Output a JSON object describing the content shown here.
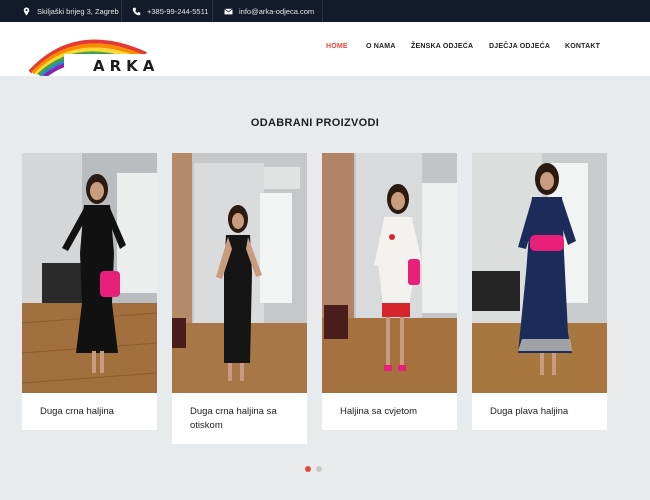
{
  "topbar": {
    "address": "Skiljaški brijeg 3, Zagreb",
    "phone": "+385-99-244-5511",
    "email": "info@arka-odjeca.com"
  },
  "brand": {
    "logo_text": "ARKA"
  },
  "nav": {
    "items": [
      {
        "label": "HOME",
        "active": true
      },
      {
        "label": "O NAMA",
        "active": false
      },
      {
        "label": "ŽENSKA ODJEĆA",
        "active": false
      },
      {
        "label": "DJEČJA ODJEĆA",
        "active": false
      },
      {
        "label": "KONTAKT",
        "active": false
      }
    ]
  },
  "section": {
    "title": "ODABRANI PROIZVODI"
  },
  "products": [
    {
      "name": "Duga crna haljina",
      "dress_color": "#111111"
    },
    {
      "name": "Duga crna haljina sa otiskom",
      "dress_color": "#141414"
    },
    {
      "name": "Haljina sa cvjetom",
      "dress_color": "#f4f2ef"
    },
    {
      "name": "Duga plava haljina",
      "dress_color": "#1c2c5a"
    }
  ],
  "carousel": {
    "pages": 2,
    "active_page": 1
  },
  "colors": {
    "accent": "#e54a3f",
    "topbar_bg": "#131a2a",
    "page_bg": "#e8ebee"
  }
}
